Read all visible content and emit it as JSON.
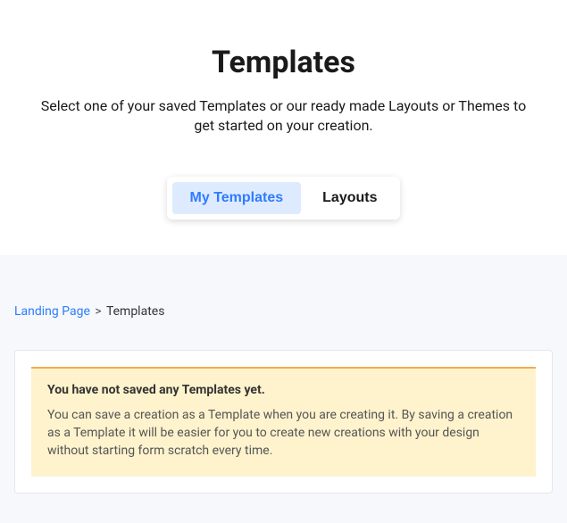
{
  "header": {
    "title": "Templates",
    "subtitle": "Select one of your saved Templates or our ready made Layouts or Themes to get started on your creation."
  },
  "tabs": {
    "my_templates": "My Templates",
    "layouts": "Layouts"
  },
  "breadcrumb": {
    "link": "Landing Page",
    "sep": ">",
    "current": "Templates"
  },
  "notice": {
    "title": "You have not saved any Templates yet.",
    "body": "You can save a creation as a Template when you are creating it. By saving a creation as a Template it will be easier for you to create new creations with your design without starting form scratch every time."
  }
}
